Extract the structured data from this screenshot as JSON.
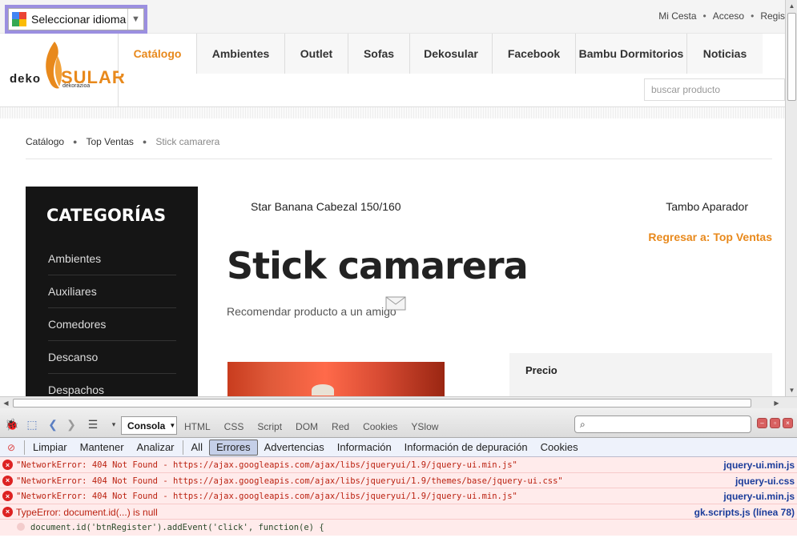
{
  "top_bar": {
    "language_selector": "Seleccionar idioma",
    "account_links": [
      "Mi Cesta",
      "Acceso",
      "Regis"
    ]
  },
  "header": {
    "logo": {
      "deko": "deko",
      "sular": "SULAR",
      "sub": "dekorazioa"
    },
    "nav": [
      "Catálogo",
      "Ambientes",
      "Outlet",
      "Sofas",
      "Dekosular",
      "Facebook",
      "Bambu Dormitorios",
      "Noticias"
    ],
    "active_nav": "Catálogo",
    "search_placeholder": "buscar producto"
  },
  "breadcrumb": [
    "Catálogo",
    "Top Ventas",
    "Stick camarera"
  ],
  "sidebar": {
    "title": "CATEGORÍAS",
    "items": [
      "Ambientes",
      "Auxiliares",
      "Comedores",
      "Descanso",
      "Despachos"
    ]
  },
  "product": {
    "prev": "Star Banana Cabezal 150/160",
    "next": "Tambo Aparador",
    "back": "Regresar a: Top Ventas",
    "title": "Stick camarera",
    "recommend": "Recomendar producto a un amigo",
    "price_label": "Precio"
  },
  "firebug": {
    "console_select": "Consola",
    "tabs": [
      "HTML",
      "CSS",
      "Script",
      "DOM",
      "Red",
      "Cookies",
      "YSlow"
    ],
    "filters": [
      "Limpiar",
      "Mantener",
      "Analizar",
      "All",
      "Errores",
      "Advertencias",
      "Información",
      "Información de depuración",
      "Cookies"
    ],
    "active_filter": "Errores",
    "log": [
      {
        "message": "\"NetworkError: 404 Not Found - https://ajax.googleapis.com/ajax/libs/jqueryui/1.9/jquery-ui.min.js\"",
        "source": "jquery-ui.min.js"
      },
      {
        "message": "\"NetworkError: 404 Not Found - https://ajax.googleapis.com/ajax/libs/jqueryui/1.9/themes/base/jquery-ui.css\"",
        "source": "jquery-ui.css"
      },
      {
        "message": "\"NetworkError: 404 Not Found - https://ajax.googleapis.com/ajax/libs/jqueryui/1.9/jquery-ui.min.js\"",
        "source": "jquery-ui.min.js"
      },
      {
        "message": "TypeError: document.id(...) is null",
        "source": "gk.scripts.js (línea 78)"
      }
    ],
    "code_line": "document.id('btnRegister').addEvent('click', function(e) {"
  },
  "colors": {
    "accent": "#e8891c",
    "sidebar_bg": "#151515",
    "error_bg": "#ffebeb",
    "error_text": "#b21",
    "source_link": "#1a3c9a"
  }
}
